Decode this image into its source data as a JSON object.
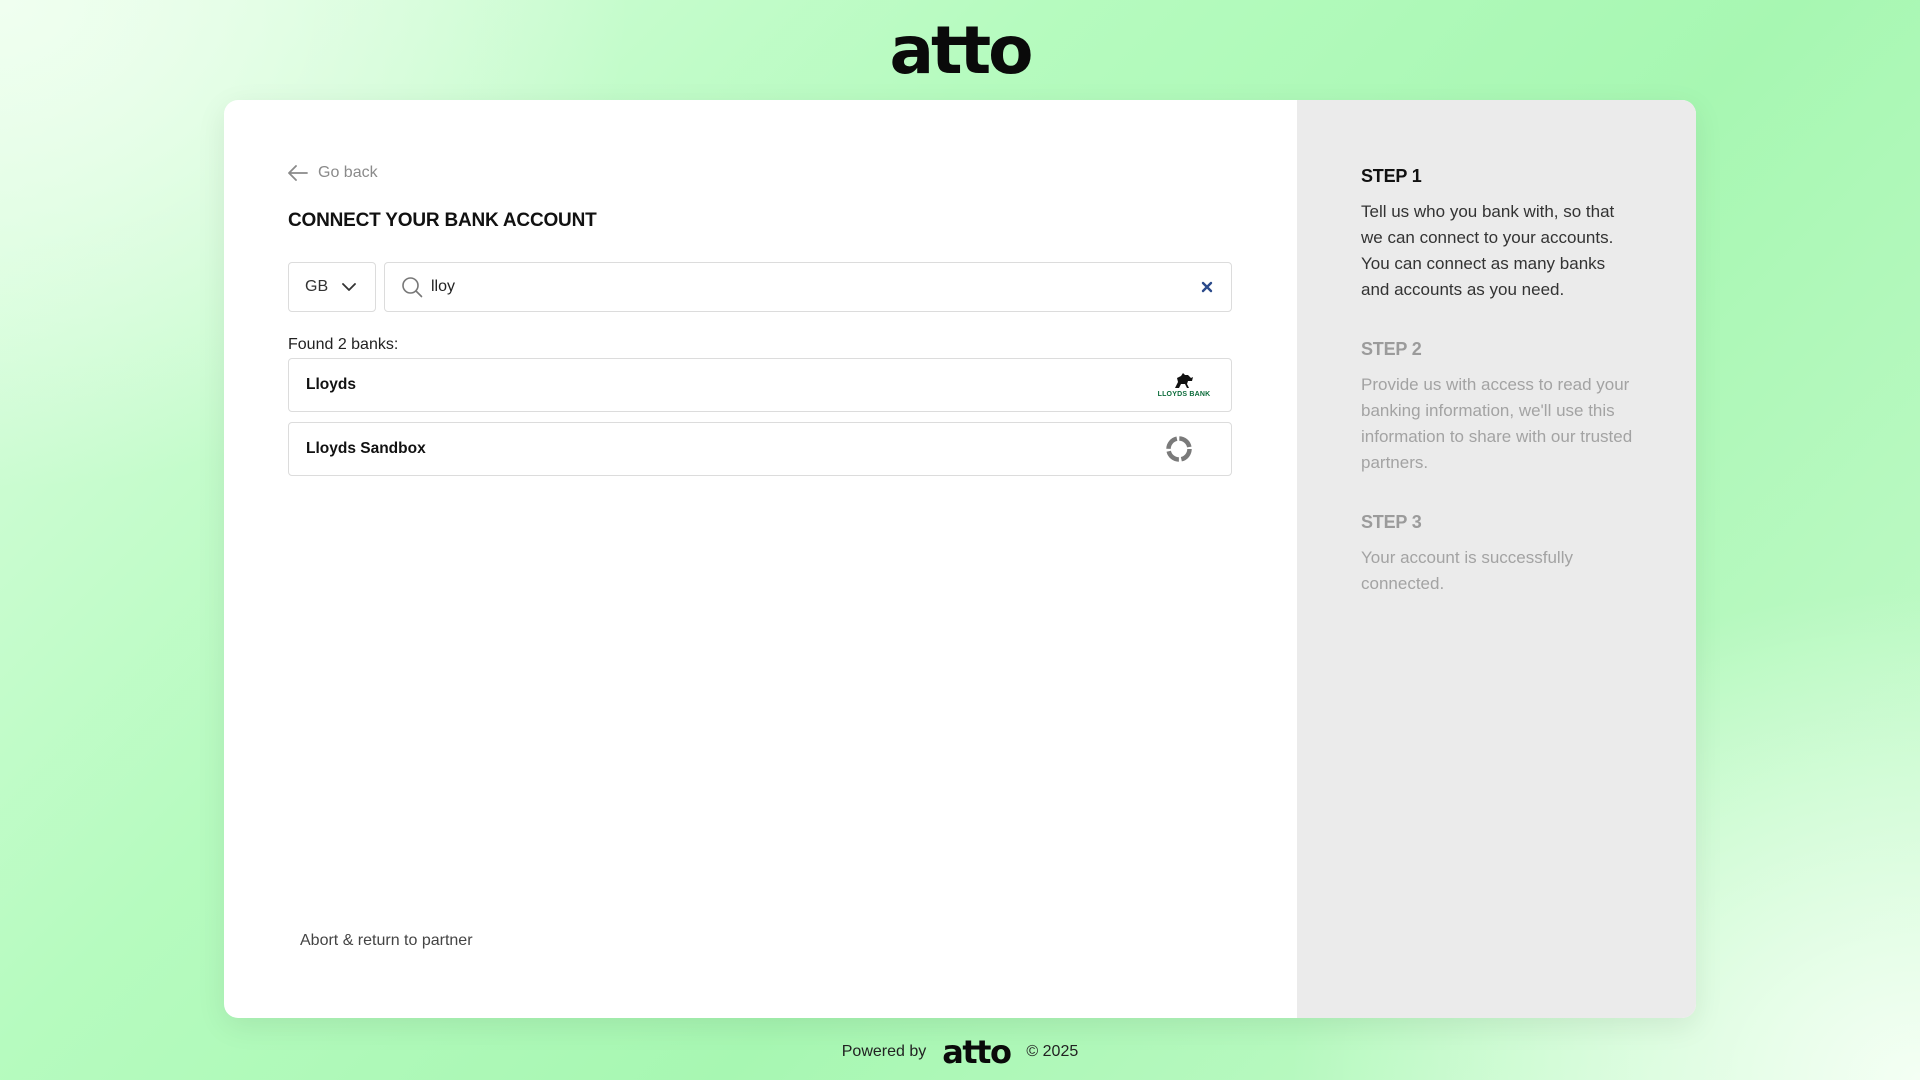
{
  "brand": {
    "logo_text": "atto"
  },
  "connect": {
    "go_back_label": "Go back",
    "title": "CONNECT YOUR BANK ACCOUNT",
    "country": {
      "selected": "GB"
    },
    "search": {
      "value": "lloy",
      "placeholder": ""
    },
    "found_label": "Found 2 banks:",
    "banks": [
      {
        "name": "Lloyds",
        "logo": "lloyds-bank-logo",
        "logo_text": "LLOYDS BANK"
      },
      {
        "name": "Lloyds Sandbox",
        "logo": "generic-bank-icon"
      }
    ],
    "abort_label": "Abort & return to partner"
  },
  "steps": [
    {
      "title": "STEP 1",
      "text": "Tell us who you bank with, so that we can connect to your accounts. You can connect as many banks and accounts as you need.",
      "state": "active"
    },
    {
      "title": "STEP 2",
      "text": "Provide us with access to read your banking information, we'll use this information to share with our trusted partners.",
      "state": "inactive"
    },
    {
      "title": "STEP 3",
      "text": "Your account is successfully connected.",
      "state": "inactive"
    }
  ],
  "footer": {
    "powered_by": "Powered by",
    "logo_text": "atto",
    "copyright": "© 2025"
  },
  "colors": {
    "accent_green": "#b6fbbf",
    "clear_icon": "#2b4a8b",
    "lloyds_green": "#0b6b3a"
  }
}
